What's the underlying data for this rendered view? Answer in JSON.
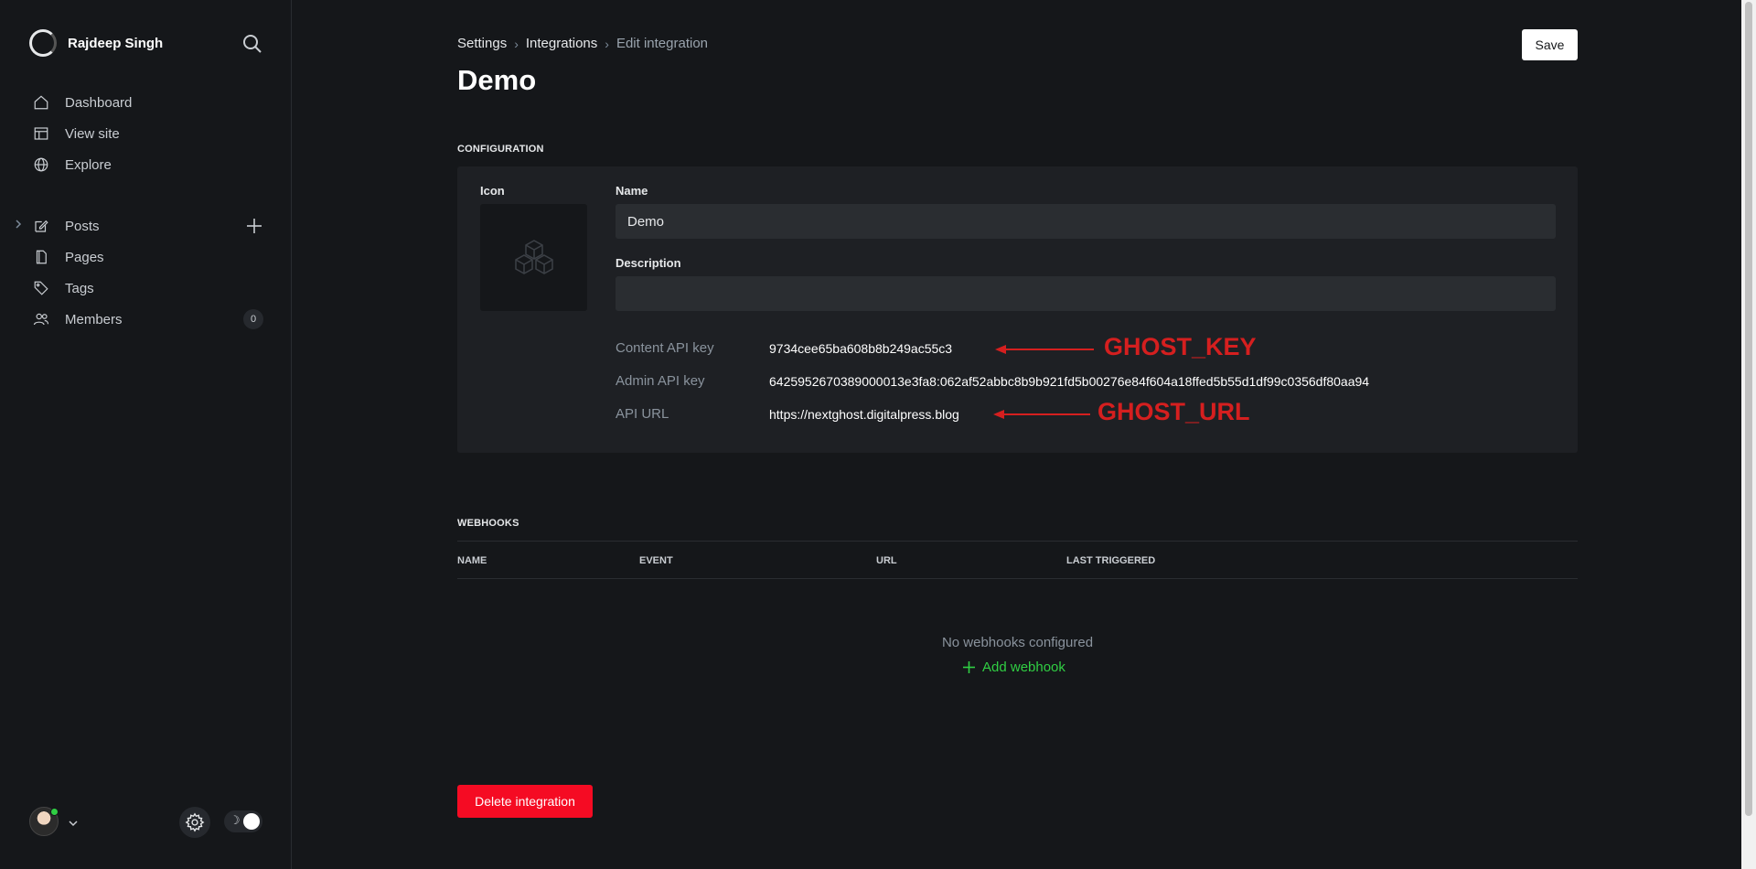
{
  "sidebar": {
    "site_name": "Rajdeep Singh",
    "nav_top": [
      {
        "label": "Dashboard",
        "icon": "home-icon"
      },
      {
        "label": "View site",
        "icon": "layout-icon"
      },
      {
        "label": "Explore",
        "icon": "globe-icon"
      }
    ],
    "nav_content": [
      {
        "label": "Posts",
        "icon": "edit-icon"
      },
      {
        "label": "Pages",
        "icon": "page-icon"
      },
      {
        "label": "Tags",
        "icon": "tag-icon"
      },
      {
        "label": "Members",
        "icon": "members-icon"
      }
    ],
    "members_count": "0"
  },
  "breadcrumb": {
    "settings": "Settings",
    "integrations": "Integrations",
    "current": "Edit integration"
  },
  "header": {
    "save_label": "Save",
    "title": "Demo"
  },
  "configuration": {
    "section_title": "CONFIGURATION",
    "icon_label": "Icon",
    "name_label": "Name",
    "name_value": "Demo",
    "description_label": "Description",
    "description_value": "",
    "content_api_key_label": "Content API key",
    "content_api_key_value": "9734cee65ba608b8b249ac55c3",
    "admin_api_key_label": "Admin API key",
    "admin_api_key_value": "6425952670389000013e3fa8:062af52abbc8b9b921fd5b00276e84f604a18ffed5b55d1df99c0356df80aa94",
    "api_url_label": "API URL",
    "api_url_value": "https://nextghost.digitalpress.blog"
  },
  "annotations": {
    "ghost_key": "GHOST_KEY",
    "ghost_url": "GHOST_URL",
    "color": "#d51f1f"
  },
  "webhooks": {
    "section_title": "WEBHOOKS",
    "columns": [
      "NAME",
      "EVENT",
      "URL",
      "LAST TRIGGERED"
    ],
    "empty_text": "No webhooks configured",
    "add_label": "Add webhook"
  },
  "footer": {
    "delete_label": "Delete integration"
  },
  "colors": {
    "accent_green": "#30cf43",
    "danger_red": "#f50b23",
    "background": "#15171a"
  }
}
